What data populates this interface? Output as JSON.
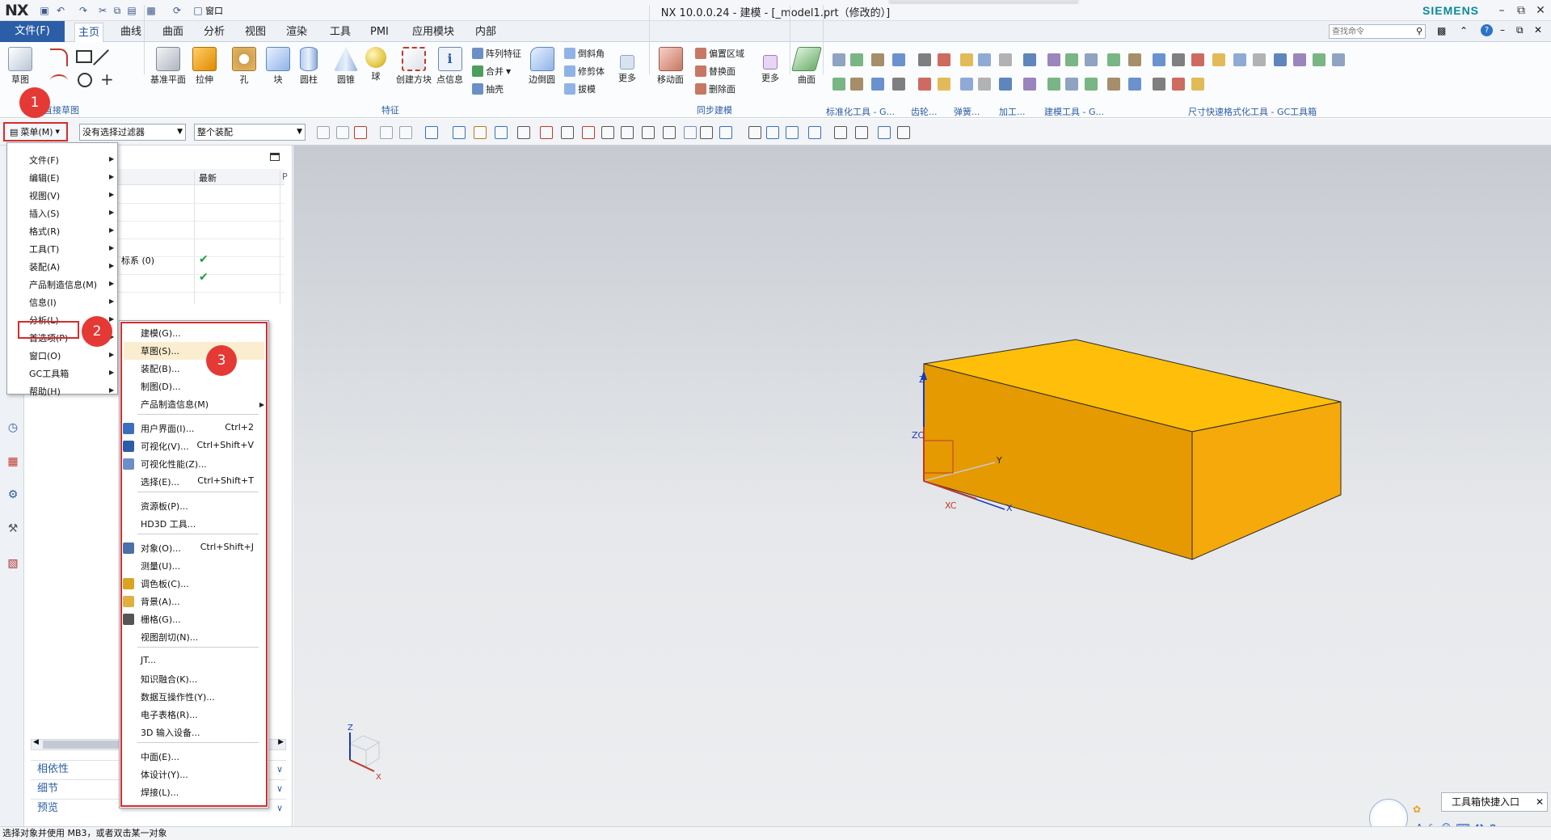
{
  "app": {
    "logo": "NX",
    "title": "NX 10.0.0.24 - 建模 - [_model1.prt（修改的）]",
    "brand": "SIEMENS",
    "window_menu": "窗口"
  },
  "tabs": {
    "file": "文件(F)",
    "items": [
      "主页",
      "曲线",
      "曲面",
      "分析",
      "视图",
      "渲染",
      "工具",
      "PMI",
      "应用模块",
      "内部"
    ]
  },
  "search": {
    "placeholder": "查找命令"
  },
  "ribbon": {
    "sketch": "草图",
    "direct_sketch": "直接草图",
    "feature_buttons": [
      "基准平面",
      "拉伸",
      "孔",
      "块",
      "圆柱",
      "圆锥",
      "球",
      "创建方块",
      "点信息"
    ],
    "feature_small": [
      "阵列特征",
      "合并",
      "抽壳"
    ],
    "edge_blend": "边倒圆",
    "edge_small": [
      "倒斜角",
      "修剪体",
      "拔模"
    ],
    "more": "更多",
    "feature_group": "特征",
    "sync_button": "移动面",
    "sync_small": [
      "偏置区域",
      "替换面",
      "删除面"
    ],
    "sync_group": "同步建模",
    "surface": "曲面",
    "groups": [
      "标准化工具 - G...",
      "齿轮...",
      "弹簧...",
      "加工...",
      "建模工具 - G...",
      "尺寸快速格式化工具 - GC工具箱"
    ]
  },
  "toolbar": {
    "menu_button": "菜单(M)",
    "filter": "没有选择过滤器",
    "assembly": "整个装配"
  },
  "navigator": {
    "col_latest": "最新",
    "rows": [
      "",
      "",
      "",
      "",
      "标系 (0)",
      ""
    ],
    "panels": [
      "相依性",
      "细节",
      "预览"
    ]
  },
  "main_menu": [
    "文件(F)",
    "编辑(E)",
    "视图(V)",
    "插入(S)",
    "格式(R)",
    "工具(T)",
    "装配(A)",
    "产品制造信息(M)",
    "信息(I)",
    "分析(L)",
    "首选项(P)",
    "窗口(O)",
    "GC工具箱",
    "帮助(H)"
  ],
  "pref_menu": [
    {
      "label": "建模(G)...",
      "shortcut": ""
    },
    {
      "label": "草图(S)...",
      "shortcut": ""
    },
    {
      "label": "装配(B)...",
      "shortcut": ""
    },
    {
      "label": "制图(D)...",
      "shortcut": ""
    },
    {
      "label": "产品制造信息(M)",
      "shortcut": ""
    },
    {
      "label": "用户界面(I)...",
      "shortcut": "Ctrl+2"
    },
    {
      "label": "可视化(V)...",
      "shortcut": "Ctrl+Shift+V"
    },
    {
      "label": "可视化性能(Z)...",
      "shortcut": ""
    },
    {
      "label": "选择(E)...",
      "shortcut": "Ctrl+Shift+T"
    },
    {
      "label": "资源板(P)...",
      "shortcut": ""
    },
    {
      "label": "HD3D 工具...",
      "shortcut": ""
    },
    {
      "label": "对象(O)...",
      "shortcut": "Ctrl+Shift+J"
    },
    {
      "label": "测量(U)...",
      "shortcut": ""
    },
    {
      "label": "调色板(C)...",
      "shortcut": ""
    },
    {
      "label": "背景(A)...",
      "shortcut": ""
    },
    {
      "label": "栅格(G)...",
      "shortcut": ""
    },
    {
      "label": "视图剖切(N)...",
      "shortcut": ""
    },
    {
      "label": "JT...",
      "shortcut": ""
    },
    {
      "label": "知识融合(K)...",
      "shortcut": ""
    },
    {
      "label": "数据互操作性(Y)...",
      "shortcut": ""
    },
    {
      "label": "电子表格(R)...",
      "shortcut": ""
    },
    {
      "label": "3D 输入设备...",
      "shortcut": ""
    },
    {
      "label": "中面(E)...",
      "shortcut": ""
    },
    {
      "label": "体设计(Y)...",
      "shortcut": ""
    },
    {
      "label": "焊接(L)...",
      "shortcut": ""
    }
  ],
  "badges": [
    "1",
    "2",
    "3"
  ],
  "axes": {
    "z": "Z",
    "zc": "ZC",
    "y": "Y",
    "xc": "XC",
    "x": "X",
    "mini_z": "Z",
    "mini_x": "X"
  },
  "toolbox_popup": "工具箱快捷入口",
  "status": "选择对象并使用 MB3，或者双击某一对象",
  "colors": {
    "accent": "#2b5ea7",
    "highlight": "#d62c2c",
    "block_top": "#ffbe0a",
    "block_front": "#e49a00"
  }
}
